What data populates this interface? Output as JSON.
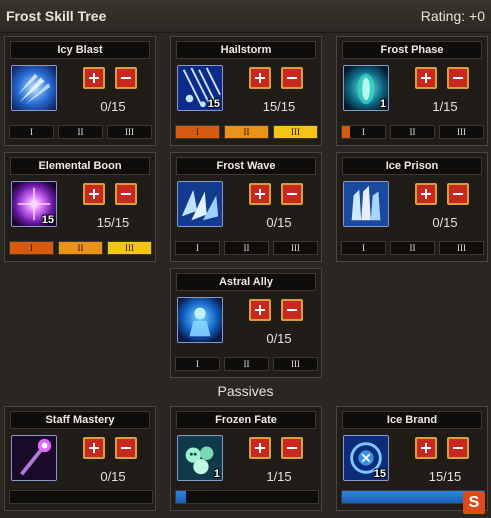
{
  "header": {
    "title": "Frost Skill Tree",
    "rating": "Rating: +0"
  },
  "skills": [
    {
      "name": "Icy Blast",
      "level_badge": "",
      "points": "0/15",
      "tiers": [
        "I",
        "II",
        "III"
      ],
      "tier_fill": 0
    },
    {
      "name": "Hailstorm",
      "level_badge": "15",
      "points": "15/15",
      "tiers": [
        "I",
        "II",
        "III"
      ],
      "tier_fill": 1
    },
    {
      "name": "Frost Phase",
      "level_badge": "1",
      "points": "1/15",
      "tiers": [
        "I",
        "II",
        "III"
      ],
      "tier_fill": 0.067
    },
    {
      "name": "Elemental Boon",
      "level_badge": "15",
      "points": "15/15",
      "tiers": [
        "I",
        "II",
        "III"
      ],
      "tier_fill": 1
    },
    {
      "name": "Frost Wave",
      "level_badge": "",
      "points": "0/15",
      "tiers": [
        "I",
        "II",
        "III"
      ],
      "tier_fill": 0
    },
    {
      "name": "Ice Prison",
      "level_badge": "",
      "points": "0/15",
      "tiers": [
        "I",
        "II",
        "III"
      ],
      "tier_fill": 0
    },
    {
      "name": "Astral Ally",
      "level_badge": "",
      "points": "0/15",
      "tiers": [
        "I",
        "II",
        "III"
      ],
      "tier_fill": 0
    }
  ],
  "passives_title": "Passives",
  "passives": [
    {
      "name": "Staff Mastery",
      "level_badge": "",
      "points": "0/15",
      "progress": 0
    },
    {
      "name": "Frozen Fate",
      "level_badge": "1",
      "points": "1/15",
      "progress": 0.067
    },
    {
      "name": "Ice Brand",
      "level_badge": "15",
      "points": "15/15",
      "progress": 1
    }
  ],
  "icons": {
    "skills": [
      "icy-blast-icon",
      "hailstorm-icon",
      "frost-phase-icon",
      "elemental-boon-icon",
      "frost-wave-icon",
      "ice-prison-icon",
      "astral-ally-icon"
    ],
    "passives": [
      "staff-mastery-icon",
      "frozen-fate-icon",
      "ice-brand-icon"
    ]
  },
  "colors": {
    "tier1": "#d55a0f",
    "tier2": "#e9921a",
    "tier3": "#f5c515",
    "progress": "#2f86e0",
    "button": "#c8281f",
    "button_border": "#d6a13a"
  }
}
